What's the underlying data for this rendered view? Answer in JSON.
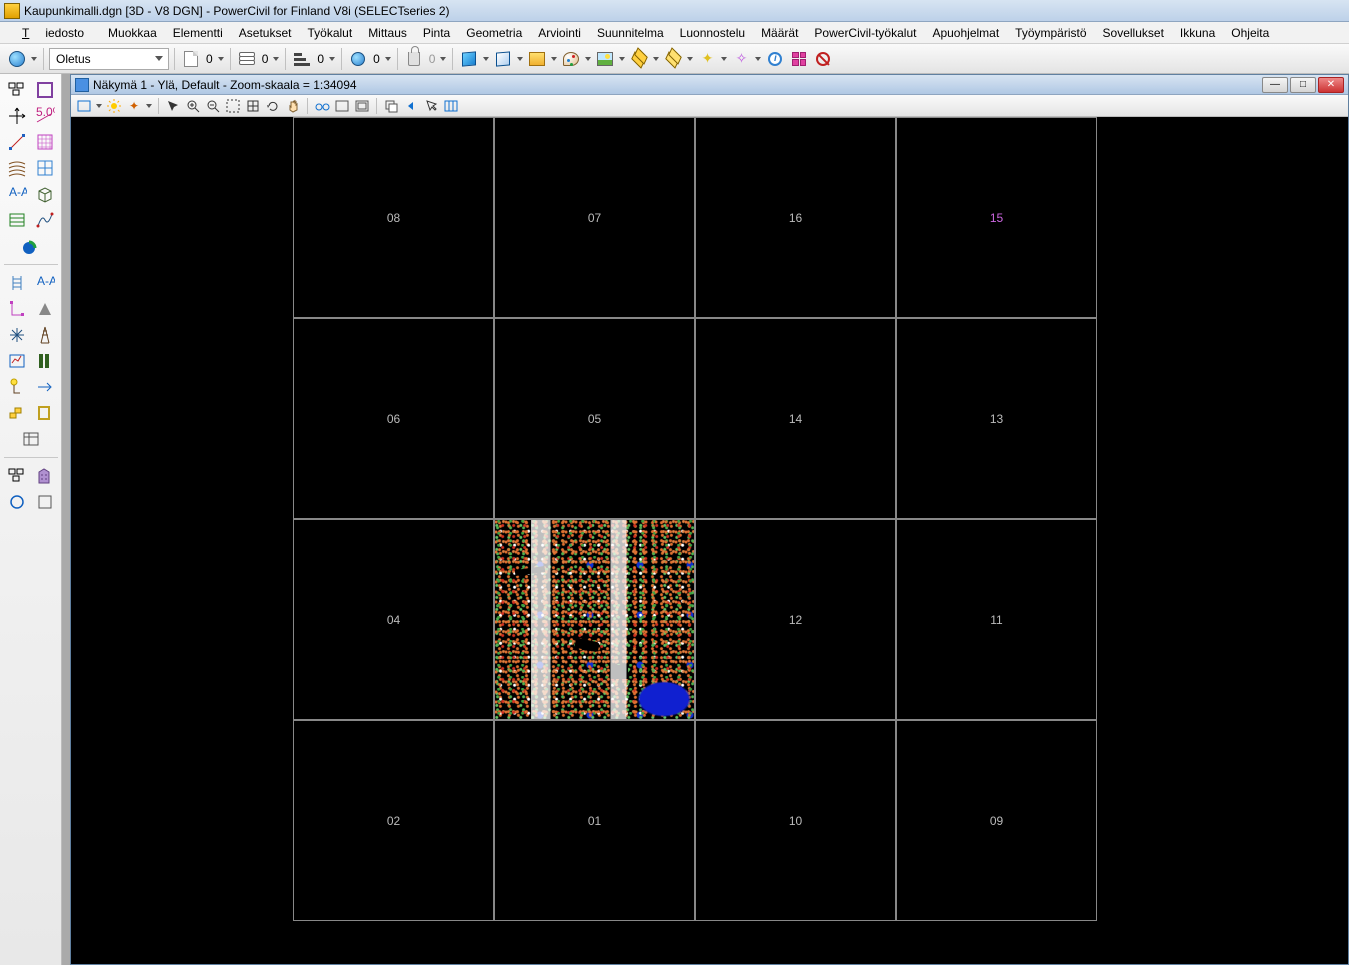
{
  "titlebar": {
    "text": "Kaupunkimalli.dgn [3D - V8 DGN] - PowerCivil for Finland V8i (SELECTseries 2)"
  },
  "menu": {
    "items": [
      "Tiedosto",
      "Muokkaa",
      "Elementti",
      "Asetukset",
      "Työkalut",
      "Mittaus",
      "Pinta",
      "Geometria",
      "Arviointi",
      "Suunnitelma",
      "Luonnostelu",
      "Määrät",
      "PowerCivil-työkalut",
      "Apuohjelmat",
      "Työympäristö",
      "Sovellukset",
      "Ikkuna",
      "Ohjeita"
    ]
  },
  "main_toolbar": {
    "style_combo": "Oletus",
    "sheet_value": "0",
    "stack_value": "0",
    "level_value": "0",
    "globe_value": "0",
    "lock_value": "0"
  },
  "inner_window": {
    "title": "Näkymä 1 - Ylä, Default - Zoom-skaala = 1:34094"
  },
  "canvas": {
    "rows": [
      [
        {
          "label": "08"
        },
        {
          "label": "07"
        },
        {
          "label": "16"
        },
        {
          "label": "15",
          "gold": true
        }
      ],
      [
        {
          "label": "06"
        },
        {
          "label": "05"
        },
        {
          "label": "14"
        },
        {
          "label": "13"
        }
      ],
      [
        {
          "label": "04"
        },
        {
          "label": "",
          "data": true
        },
        {
          "label": "12"
        },
        {
          "label": "11"
        }
      ],
      [
        {
          "label": "02"
        },
        {
          "label": "01"
        },
        {
          "label": "10"
        },
        {
          "label": "09"
        }
      ]
    ]
  }
}
